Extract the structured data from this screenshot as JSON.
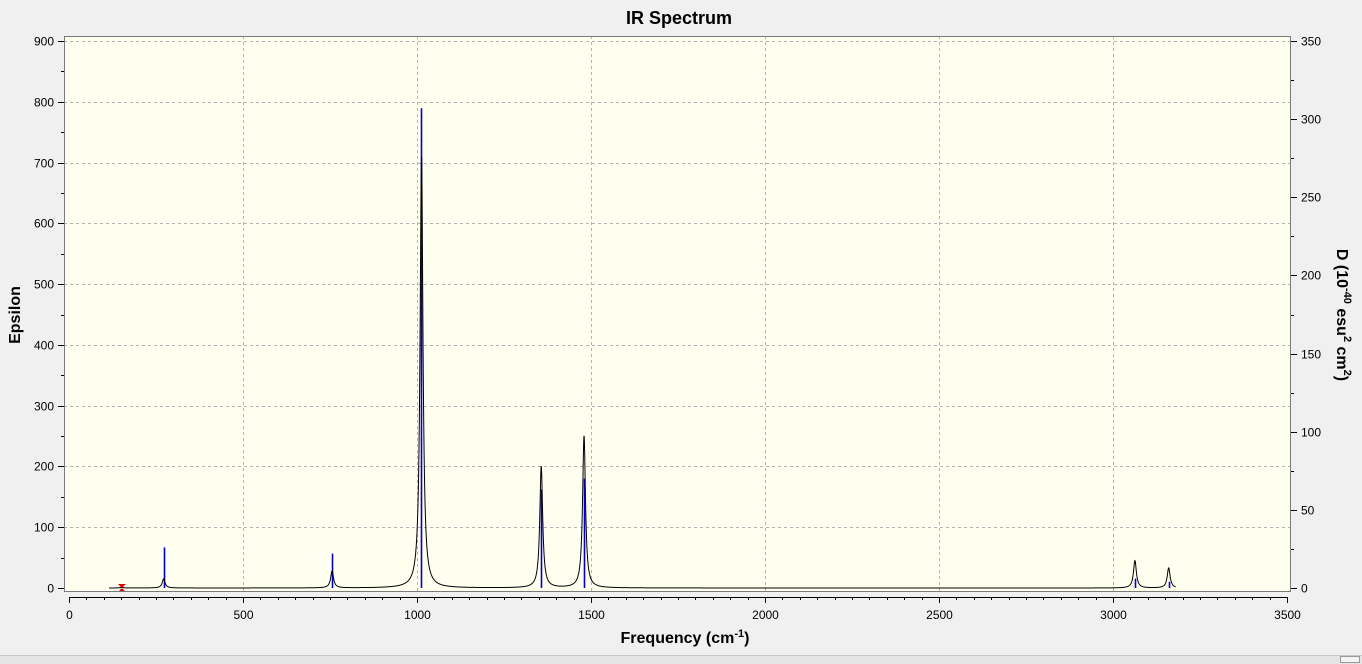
{
  "chart_data": {
    "type": "line",
    "title": "IR Spectrum",
    "xlabel": "Frequency (cm-1)",
    "xlabel_main": "Frequency (cm",
    "xlabel_sup": "-1",
    "xlabel_close": ")",
    "ylabel": "Epsilon",
    "y2label": "D (10-40 esu2 cm2)",
    "y2label_parts": [
      "D (10",
      "-40",
      " esu",
      "2",
      " cm",
      "2",
      ")"
    ],
    "xlim": [
      0,
      3500
    ],
    "ylim": [
      0,
      900
    ],
    "y2lim": [
      0,
      350
    ],
    "xticks": [
      0,
      500,
      1000,
      1500,
      2000,
      2500,
      3000,
      3500
    ],
    "yticks": [
      0,
      100,
      200,
      300,
      400,
      500,
      600,
      700,
      800,
      900
    ],
    "y2ticks": [
      0,
      50,
      100,
      150,
      200,
      250,
      300,
      350
    ],
    "grid": true,
    "colors": {
      "spectrum": "#000000",
      "sticks": "#0000cc",
      "marker": "#dd0000",
      "plot_bg": "#fffff0",
      "grid": "#b4b4b4"
    },
    "series": [
      {
        "kind": "spectrum",
        "peaks": [
          {
            "x": 152,
            "epsilon": 1
          },
          {
            "x": 272,
            "epsilon": 15
          },
          {
            "x": 756,
            "epsilon": 28
          },
          {
            "x": 1013,
            "epsilon": 710
          },
          {
            "x": 1357,
            "epsilon": 200
          },
          {
            "x": 1480,
            "epsilon": 250
          },
          {
            "x": 3063,
            "epsilon": 45
          },
          {
            "x": 3160,
            "epsilon": 33
          }
        ],
        "hwhm": 5
      },
      {
        "kind": "sticks",
        "points": [
          {
            "x": 272,
            "D": 26
          },
          {
            "x": 756,
            "D": 22
          },
          {
            "x": 1011,
            "D": 307
          },
          {
            "x": 1357,
            "D": 63
          },
          {
            "x": 1480,
            "D": 70
          },
          {
            "x": 3063,
            "D": 6
          },
          {
            "x": 3160,
            "D": 4
          }
        ]
      }
    ],
    "marker": {
      "x": 152,
      "epsilon": 0
    }
  }
}
